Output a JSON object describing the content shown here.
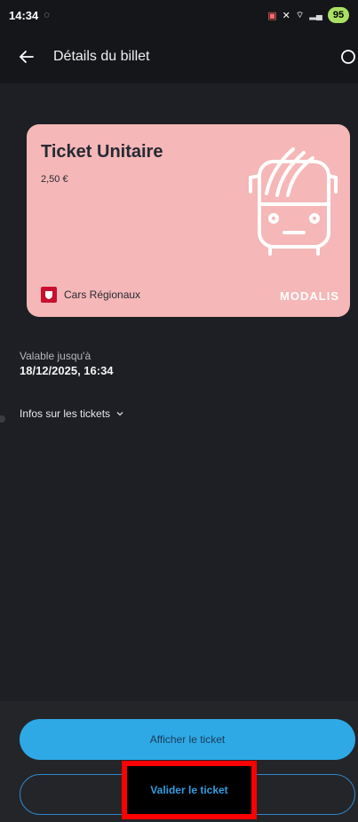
{
  "status_bar": {
    "time": "14:34",
    "battery": "95",
    "icons": [
      "notification-icon",
      "cast-icon",
      "mute-icon",
      "wifi-icon",
      "signal-icon",
      "signal-icon"
    ]
  },
  "app_bar": {
    "title": "Détails du billet",
    "back_icon": "arrow-left-icon",
    "refresh_icon": "refresh-icon"
  },
  "ticket": {
    "title": "Ticket Unitaire",
    "price": "2,50 €",
    "operator": "Cars Régionaux",
    "brand": "MODALIS",
    "background": "#f5b7b7",
    "illustration": "bus-icon"
  },
  "validity": {
    "label": "Valable jusqu'à",
    "value": "18/12/2025, 16:34"
  },
  "infos": {
    "label": "Infos sur les tickets",
    "icon": "chevron-down-icon"
  },
  "actions": {
    "show_ticket": "Afficher le ticket",
    "validate_ticket": "Valider le ticket",
    "primary_color": "#2ea9e6",
    "highlight_color": "#ff0000"
  }
}
